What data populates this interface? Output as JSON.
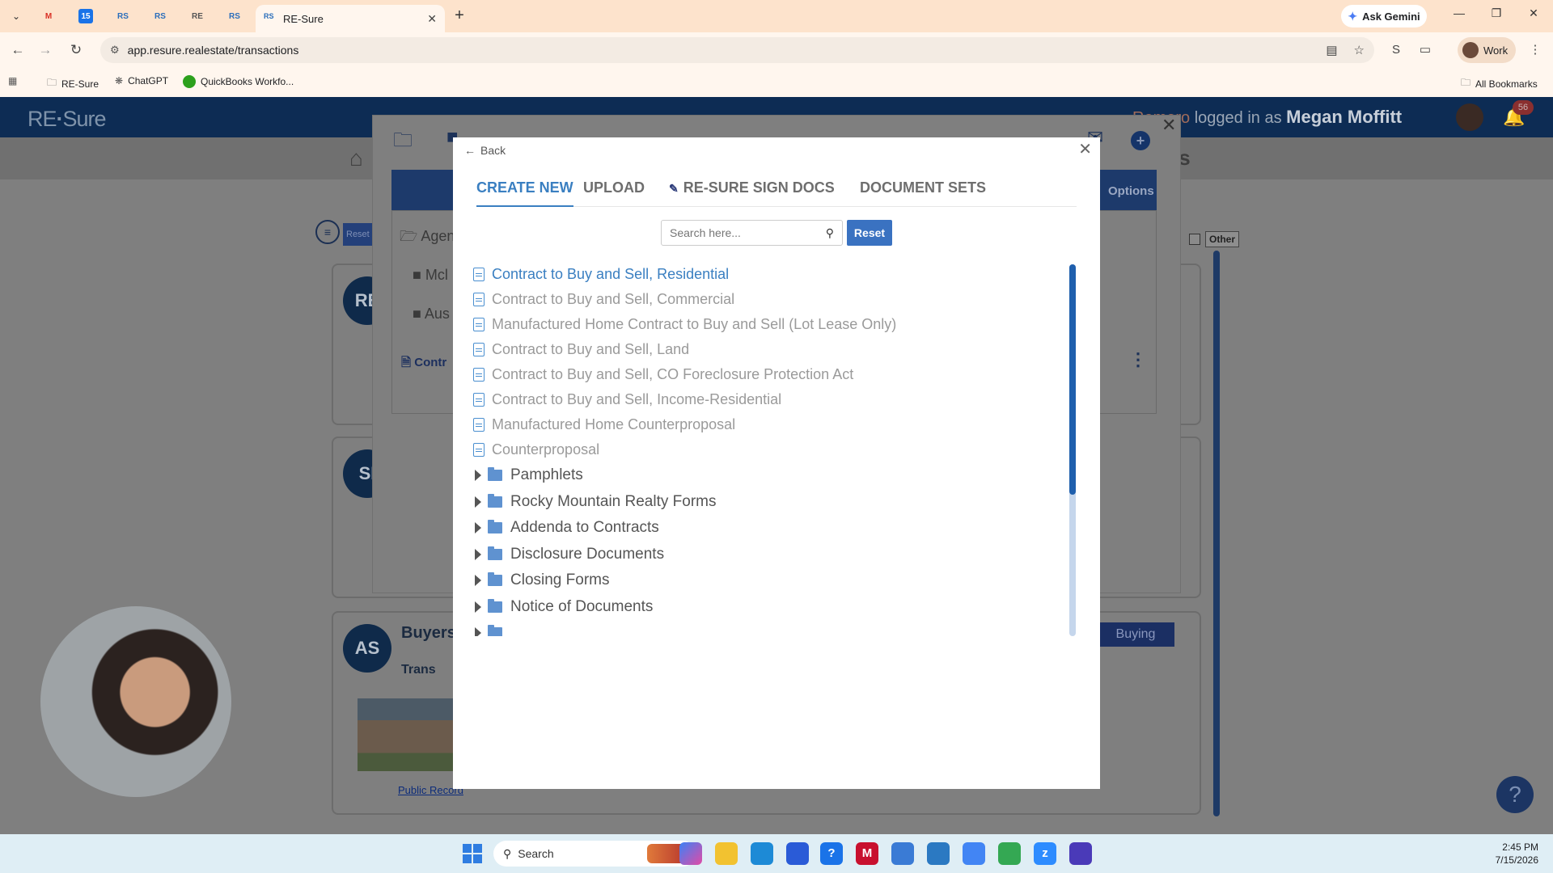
{
  "browser": {
    "active_tab_title": "RE-Sure",
    "active_tab_favicon": "RS",
    "pinned_tabs": [
      "M",
      "15",
      "RS",
      "RS",
      "RE",
      "RS"
    ],
    "ask_gemini": "Ask Gemini",
    "url": "app.resure.realestate/transactions",
    "profile_label": "Work",
    "bookmarks": [
      {
        "label": "RE-Sure",
        "icon": "folder-icon"
      },
      {
        "label": "ChatGPT",
        "icon": "chatgpt-icon"
      },
      {
        "label": "QuickBooks Workfo...",
        "icon": "quickbooks-icon"
      }
    ],
    "all_bookmarks": "All Bookmarks"
  },
  "app": {
    "logo_main": "RE",
    "logo_sub": "Sure",
    "logged_in_partial_name": "Romero",
    "logged_in_text": "logged in as",
    "logged_in_user": "Megan Moffitt",
    "notification_count": "56",
    "tools_partial": "ls",
    "reset_mini": "Reset",
    "other_label": "Other",
    "buying_label": "Buying",
    "public_record": "Public Record",
    "transaction_partial": "Trans",
    "buyers_partial": "Buyers",
    "card_initials": [
      "RE",
      "SI",
      "AS"
    ]
  },
  "outer_modal": {
    "options_label": "Options",
    "agent_partial": "Agen",
    "folder_1_partial": "Mcl",
    "folder_2_partial": "Aus",
    "contract_partial": "Contr"
  },
  "dialog": {
    "back_label": "Back",
    "tabs": [
      {
        "label": "CREATE NEW",
        "active": true
      },
      {
        "label": "UPLOAD",
        "active": false
      },
      {
        "label": "RE-SURE SIGN DOCS",
        "active": false
      },
      {
        "label": "DOCUMENT SETS",
        "active": false
      }
    ],
    "search": {
      "placeholder": "Search here...",
      "value": ""
    },
    "reset_label": "Reset",
    "documents": [
      "Contract to Buy and Sell, Residential",
      "Contract to Buy and Sell, Commercial",
      "Manufactured Home Contract to Buy and Sell (Lot Lease Only)",
      "Contract to Buy and Sell, Land",
      "Contract to Buy and Sell, CO Foreclosure Protection Act",
      "Contract to Buy and Sell, Income-Residential",
      "Manufactured Home Counterproposal",
      "Counterproposal"
    ],
    "folders": [
      "Pamphlets",
      "Rocky Mountain Realty Forms",
      "Addenda to Contracts",
      "Disclosure Documents",
      "Closing Forms",
      "Notice of Documents"
    ],
    "scroll_fraction_visible": 0.62
  },
  "taskbar": {
    "search_label": "Search",
    "time": "2:45 PM",
    "date": "7/15/2026"
  },
  "colors": {
    "accent": "#3a7fc1",
    "header_navy": "#0d2c54",
    "reset_button": "#3a72c1"
  }
}
